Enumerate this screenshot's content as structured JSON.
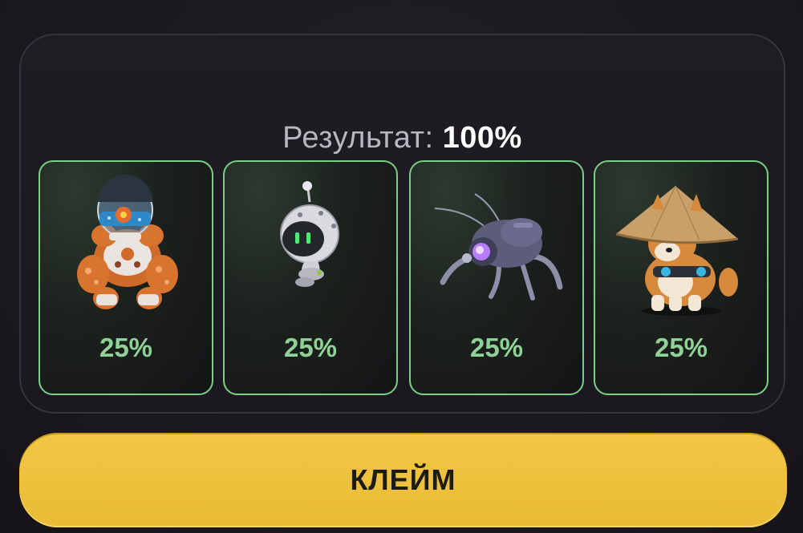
{
  "result": {
    "label": "Результат:",
    "value": "100%"
  },
  "cards": [
    {
      "icon": "diver-robot-icon",
      "percent": "25%"
    },
    {
      "icon": "drone-robot-icon",
      "percent": "25%"
    },
    {
      "icon": "spider-robot-icon",
      "percent": "25%"
    },
    {
      "icon": "shiba-dog-icon",
      "percent": "25%"
    }
  ],
  "claim_button": {
    "label": "КЛЕЙМ"
  },
  "colors": {
    "accent_green": "#8fd196",
    "card_border": "#7bcf86",
    "button_yellow": "#f0c23f",
    "background": "#1c1a20"
  }
}
